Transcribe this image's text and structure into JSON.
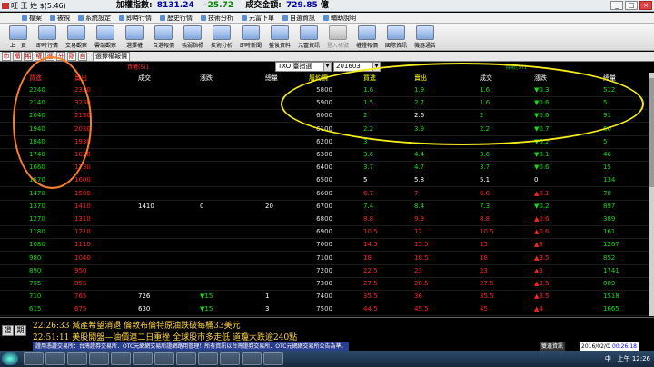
{
  "window": {
    "title": "旺 王 姓 $(5.46)",
    "index_label": "加權指數:",
    "index_value": "8131.24",
    "index_change": "-25.72",
    "amount_label": "成交金額:",
    "amount_value": "729.85",
    "amount_unit": "億"
  },
  "menu": [
    "檔案",
    "被視",
    "系統設定",
    "即時行情",
    "歷史行情",
    "技術分析",
    "元富下單",
    "自選資訊",
    "輔助說明"
  ],
  "toolbar": [
    {
      "label": "上一頁",
      "gray": false
    },
    {
      "label": "即時行情",
      "gray": false
    },
    {
      "label": "交易觀察",
      "gray": false
    },
    {
      "label": "雲端觀察",
      "gray": false
    },
    {
      "label": "選擇權",
      "gray": false
    },
    {
      "label": "自選報價",
      "gray": false
    },
    {
      "label": "強弱指標",
      "gray": false
    },
    {
      "label": "技術分析",
      "gray": false
    },
    {
      "label": "即時新聞",
      "gray": false
    },
    {
      "label": "盤後資料",
      "gray": false
    },
    {
      "label": "元富資訊",
      "gray": false
    },
    {
      "label": "登入帳號",
      "gray": true
    },
    {
      "label": "權證報價",
      "gray": false
    },
    {
      "label": "國際資訊",
      "gray": false
    },
    {
      "label": "機器通告",
      "gray": false
    }
  ],
  "subbar": {
    "buttons": [
      "市",
      "櫃",
      "期",
      "權",
      "選",
      "分",
      "剛",
      "自"
    ],
    "title": "選擇權報價"
  },
  "controls": {
    "left_label": "買權(5)1",
    "product": "TXO 臺指選",
    "month": "201603",
    "right_label": "賣權(5)1"
  },
  "headers": {
    "left": [
      "買進",
      "賣出",
      "成交",
      "漲跌",
      "總量"
    ],
    "strike": "履約價",
    "right": [
      "買進",
      "賣出",
      "成交",
      "漲跌",
      "總量"
    ]
  },
  "rows": [
    {
      "cb": "2240",
      "cs": "2330",
      "cd": "",
      "cc": "",
      "cv": "",
      "k": "5800",
      "pb": "1.6",
      "ps": "1.9",
      "pd": "1.6",
      "pc": "▼0.3",
      "pv": "512"
    },
    {
      "cb": "2140",
      "cs": "3230",
      "cd": "",
      "cc": "",
      "cv": "",
      "k": "5900",
      "pb": "1.5",
      "ps": "2.7",
      "pd": "1.6",
      "pc": "▼0.6",
      "pv": "5"
    },
    {
      "cb": "2040",
      "cs": "2130",
      "cd": "",
      "cc": "",
      "cv": "",
      "k": "6000",
      "pb": "2",
      "ps": "2.6",
      "pd": "2",
      "pc": "▼0.6",
      "pv": "91"
    },
    {
      "cb": "1940",
      "cs": "2030",
      "cd": "",
      "cc": "",
      "cv": "",
      "k": "6100",
      "pb": "2.2",
      "ps": "3.9",
      "pd": "2.2",
      "pc": "▼0.7",
      "pv": "60"
    },
    {
      "cb": "1840",
      "cs": "1930",
      "cd": "",
      "cc": "",
      "cv": "",
      "k": "6200",
      "pb": "3",
      "ps": "",
      "pd": "",
      "pc": "▼0.2",
      "pv": "5"
    },
    {
      "cb": "1740",
      "cs": "1830",
      "cd": "",
      "cc": "",
      "cv": "",
      "k": "6300",
      "pb": "3.6",
      "ps": "4.4",
      "pd": "3.6",
      "pc": "▼0.1",
      "pv": "46"
    },
    {
      "cb": "1660",
      "cs": "1730",
      "cd": "",
      "cc": "",
      "cv": "",
      "k": "6400",
      "pb": "3.7",
      "ps": "4.7",
      "pd": "3.7",
      "pc": "▼0.6",
      "pv": "15"
    },
    {
      "cb": "1570",
      "cs": "1600",
      "cd": "",
      "cc": "",
      "cv": "",
      "k": "6500",
      "pb": "5",
      "ps": "5.8",
      "pd": "5.1",
      "pc": "0",
      "pv": "134"
    },
    {
      "cb": "1470",
      "cs": "1500",
      "cd": "",
      "cc": "",
      "cv": "",
      "k": "6600",
      "pb": "6.7",
      "ps": "7",
      "pd": "6.6",
      "pc": "▲0.1",
      "pv": "70"
    },
    {
      "cb": "1370",
      "cs": "1410",
      "cd": "1410",
      "cc": "0",
      "cv": "20",
      "k": "6700",
      "pb": "7.4",
      "ps": "8.4",
      "pd": "7.3",
      "pc": "▼0.2",
      "pv": "897"
    },
    {
      "cb": "1270",
      "cs": "1310",
      "cd": "",
      "cc": "",
      "cv": "",
      "k": "6800",
      "pb": "8.8",
      "ps": "9.9",
      "pd": "8.8",
      "pc": "▲0.6",
      "pv": "389"
    },
    {
      "cb": "1180",
      "cs": "1210",
      "cd": "",
      "cc": "",
      "cv": "",
      "k": "6900",
      "pb": "10.5",
      "ps": "12",
      "pd": "10.5",
      "pc": "▲0.6",
      "pv": "161"
    },
    {
      "cb": "1080",
      "cs": "1110",
      "cd": "",
      "cc": "",
      "cv": "",
      "k": "7000",
      "pb": "14.5",
      "ps": "15.5",
      "pd": "15",
      "pc": "▲3",
      "pv": "1267"
    },
    {
      "cb": "980",
      "cs": "1040",
      "cd": "",
      "cc": "",
      "cv": "",
      "k": "7100",
      "pb": "18",
      "ps": "18.5",
      "pd": "18",
      "pc": "▲3.5",
      "pv": "852"
    },
    {
      "cb": "890",
      "cs": "950",
      "cd": "",
      "cc": "",
      "cv": "",
      "k": "7200",
      "pb": "22.5",
      "ps": "23",
      "pd": "23",
      "pc": "▲3",
      "pv": "1741"
    },
    {
      "cb": "795",
      "cs": "855",
      "cd": "",
      "cc": "",
      "cv": "",
      "k": "7300",
      "pb": "27.5",
      "ps": "28.5",
      "pd": "27.5",
      "pc": "▲3.5",
      "pv": "889"
    },
    {
      "cb": "710",
      "cs": "765",
      "cd": "726",
      "cc": "▼15",
      "cv": "1",
      "k": "7400",
      "pb": "35.5",
      "ps": "36",
      "pd": "35.5",
      "pc": "▲3.5",
      "pv": "1518"
    },
    {
      "cb": "615",
      "cs": "675",
      "cd": "630",
      "cc": "▼15",
      "cv": "3",
      "k": "7500",
      "pb": "44.5",
      "ps": "45.5",
      "pd": "45",
      "pc": "▲4",
      "pv": "1665"
    }
  ],
  "news": {
    "btns": [
      "證",
      "期",
      "權",
      "N"
    ],
    "line1": "22:26:33 減產希望消退 倫敦布倫特原油跌破每桶33美元",
    "line2": "22:51:11 美股開盤—油價連二日重挫 全球股市多走低 道瓊大跌逾240點"
  },
  "status": {
    "text": "證用憑證交易所：台灣證券交易所．OTC元網網交易所證網路用管理！所有資訊以台灣證券交易所．OTC元網網交易所公告為準。",
    "service": "雙邊資訊",
    "date": "2016/02/02",
    "time": "00:26:18",
    "tray_time": "上午 12:26",
    "tray_lang": "中"
  },
  "colors": {
    "orange_annotation": "#f97f2a",
    "yellow_annotation": "#f3eb1c",
    "up": "#ff2222",
    "down": "#11dd11"
  }
}
